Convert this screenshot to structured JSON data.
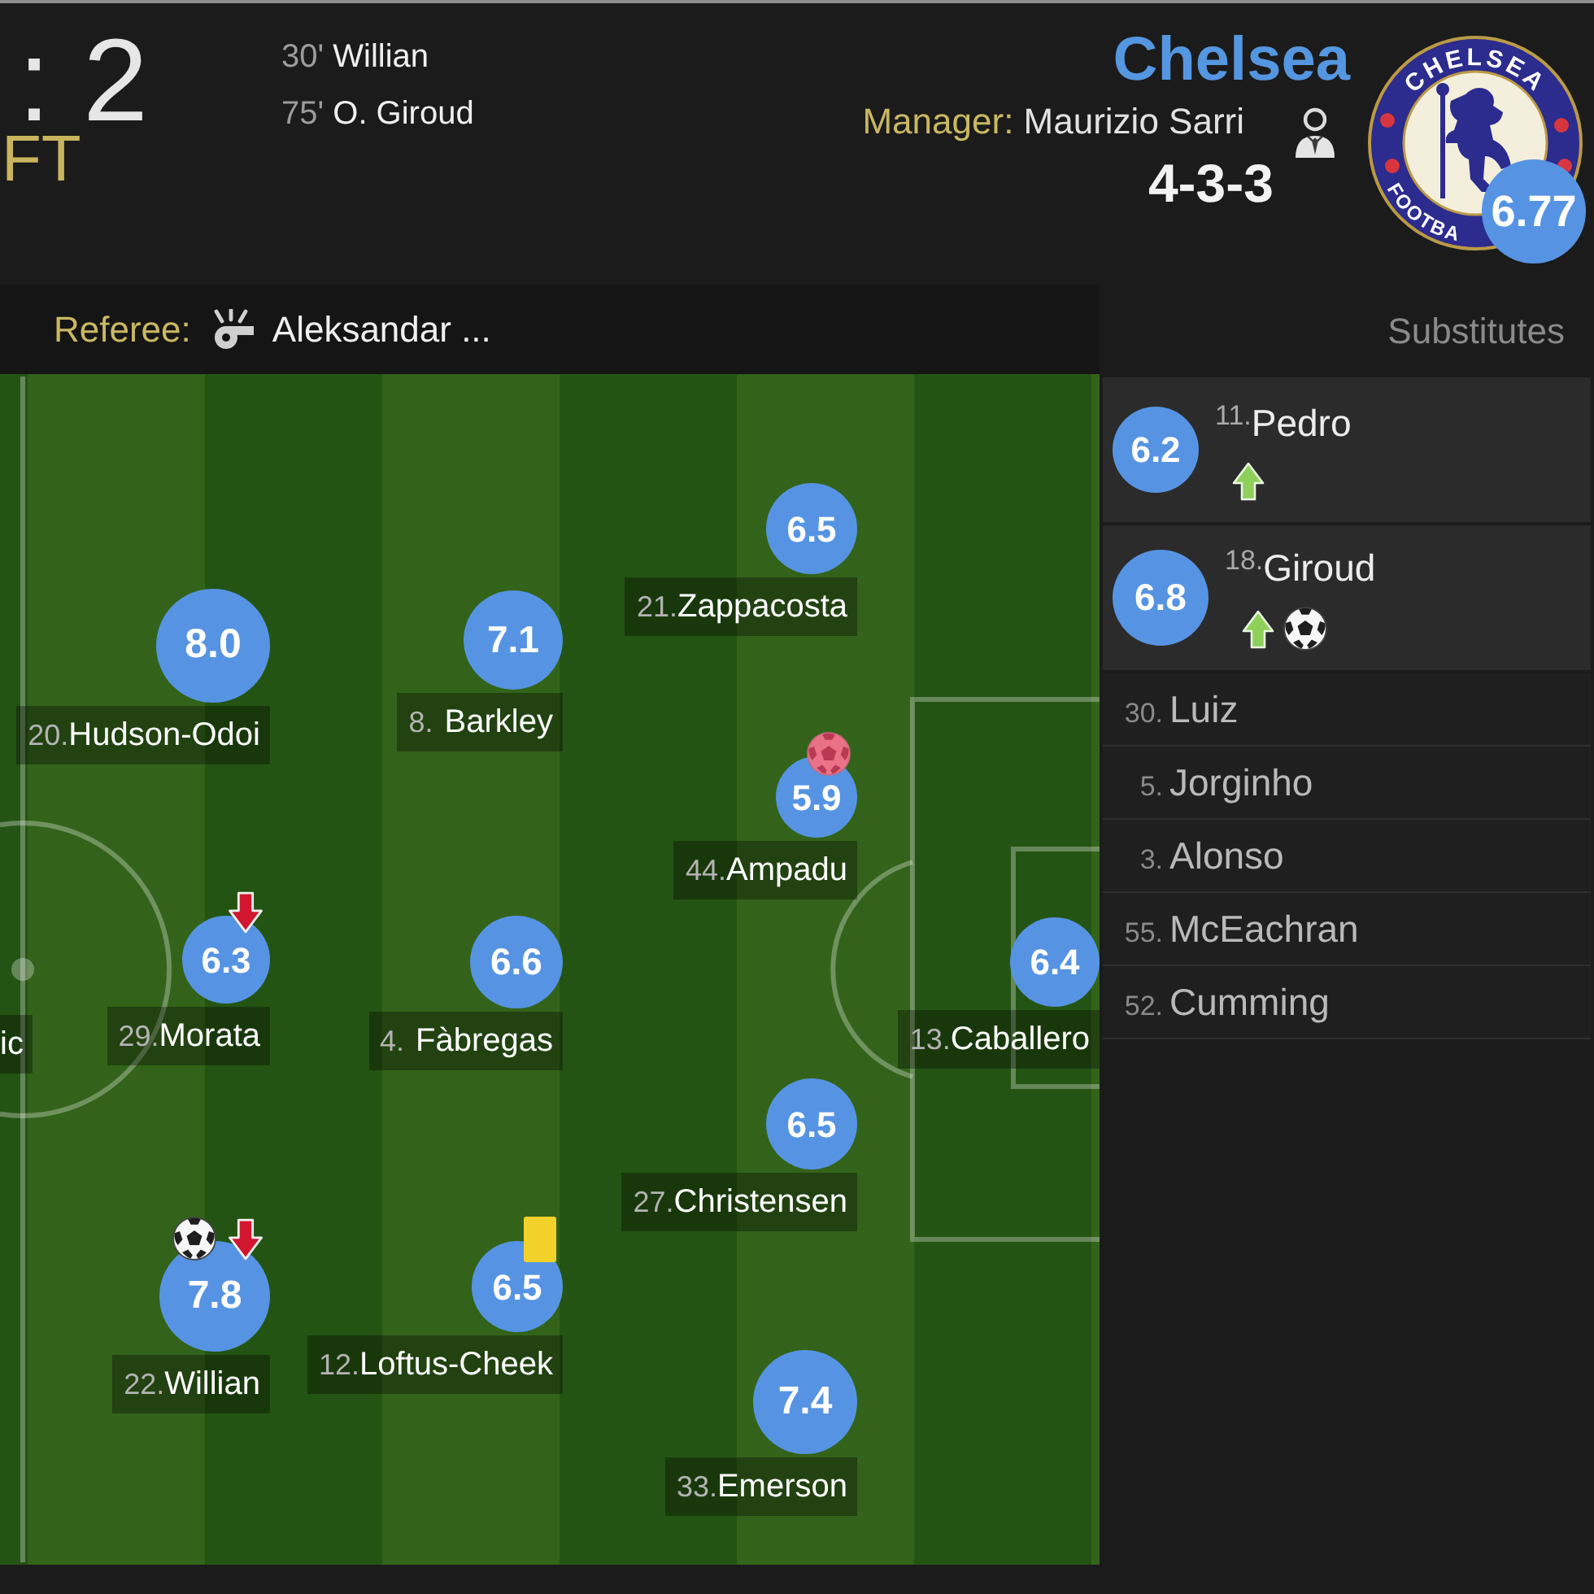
{
  "match": {
    "score": ": 2",
    "status": "FT",
    "goals": [
      {
        "minute": "30'",
        "player": "Willian"
      },
      {
        "minute": "75'",
        "player": "O. Giroud"
      }
    ]
  },
  "team": {
    "name": "Chelsea",
    "manager_label": "Manager:",
    "manager": "Maurizio Sarri",
    "formation": "4-3-3",
    "crest": {
      "top_text": "CHELSEA",
      "bottom_text": "FOOTBA"
    },
    "rating": "6.77"
  },
  "referee": {
    "label": "Referee:",
    "name": "Aleksandar ..."
  },
  "substitutes_title": "Substitutes",
  "pitch": {
    "cut_label": "ic",
    "lines": [
      {
        "players": [
          {
            "number": "20.",
            "name": "Hudson-Odoi",
            "rating": "8.0"
          },
          {
            "number": "29.",
            "name": "Morata",
            "rating": "6.3",
            "events": [
              {
                "kind": "subbed_off"
              }
            ]
          },
          {
            "number": "22.",
            "name": "Willian",
            "rating": "7.8",
            "events": [
              {
                "kind": "goal"
              },
              {
                "kind": "subbed_off"
              }
            ]
          }
        ]
      },
      {
        "players": [
          {
            "number": "8.",
            "name": "Barkley",
            "rating": "7.1"
          },
          {
            "number": "4.",
            "name": "Fàbregas",
            "rating": "6.6"
          },
          {
            "number": "12.",
            "name": "Loftus-Cheek",
            "rating": "6.5",
            "events": [
              {
                "kind": "yellow_card"
              }
            ]
          }
        ]
      },
      {
        "players": [
          {
            "number": "21.",
            "name": "Zappacosta",
            "rating": "6.5"
          },
          {
            "number": "44.",
            "name": "Ampadu",
            "rating": "5.9",
            "events": [
              {
                "kind": "red_ball"
              }
            ]
          },
          {
            "number": "27.",
            "name": "Christensen",
            "rating": "6.5"
          },
          {
            "number": "33.",
            "name": "Emerson",
            "rating": "7.4"
          }
        ]
      },
      {
        "players": [
          {
            "number": "13.",
            "name": "Caballero",
            "rating": "6.4"
          }
        ]
      }
    ]
  },
  "substitutes": [
    {
      "kind": "played",
      "number": "11.",
      "name": "Pedro",
      "rating": "6.2",
      "events": [
        {
          "kind": "subbed_on"
        }
      ]
    },
    {
      "kind": "played",
      "number": "18.",
      "name": "Giroud",
      "rating": "6.8",
      "events": [
        {
          "kind": "subbed_on"
        },
        {
          "kind": "goal"
        }
      ]
    },
    {
      "kind": "unused",
      "number": "30.",
      "name": "Luiz"
    },
    {
      "kind": "unused",
      "number": "5.",
      "name": "Jorginho"
    },
    {
      "kind": "unused",
      "number": "3.",
      "name": "Alonso"
    },
    {
      "kind": "unused",
      "number": "55.",
      "name": "McEachran"
    },
    {
      "kind": "unused",
      "number": "52.",
      "name": "Cumming"
    }
  ]
}
